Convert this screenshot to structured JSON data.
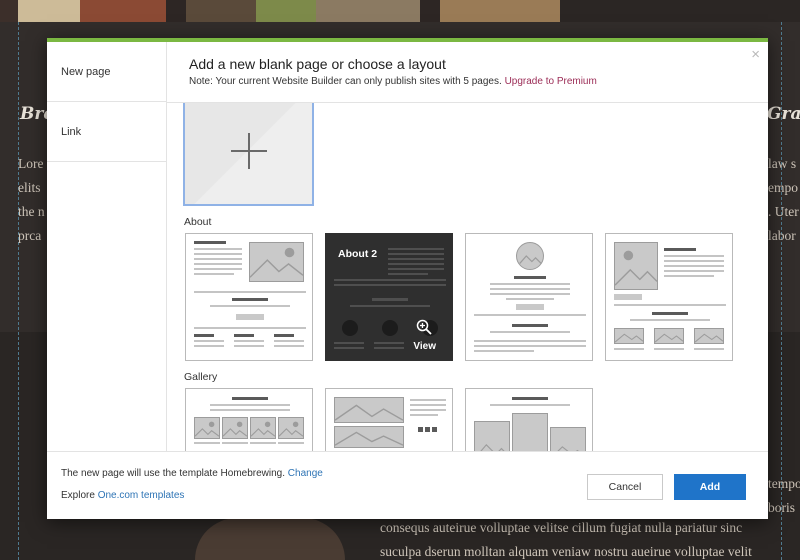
{
  "background": {
    "heading_left": "Bre",
    "heading_right": "Grai",
    "left_lines": [
      "Lore",
      "elits",
      "the n",
      "prca"
    ],
    "right_lines": [
      "law s",
      "empo",
      ". Uter",
      "labor"
    ],
    "right_low_lines": [
      "tempo",
      "boris"
    ],
    "bottom_lines": [
      "consequs auteiruе volluptae velitse cillum fugiat nulla pariatur sinc",
      "suculpa dserun molltan alquam veniaw nostru aueiruе volluptae velit"
    ]
  },
  "modal": {
    "close_label": "×",
    "sidebar": {
      "items": [
        {
          "label": "New page"
        },
        {
          "label": "Link"
        }
      ]
    },
    "header": {
      "title": "Add a new blank page or choose a layout",
      "note": "Note: Your current Website Builder can only publish sites with 5 pages.",
      "upgrade_link": "Upgrade to Premium"
    },
    "sections": {
      "about": "About",
      "gallery": "Gallery"
    },
    "about_hover": {
      "title": "About 2",
      "view_label": "View"
    },
    "footer": {
      "template_text": "The new page will use the template Homebrewing.",
      "change_link": "Change",
      "explore_text": "Explore",
      "templates_link": "One.com templates",
      "cancel_label": "Cancel",
      "add_label": "Add"
    },
    "colors": {
      "accent_green": "#7bb842",
      "primary_blue": "#1f74c9",
      "link_blue": "#2e74b5",
      "upgrade_link": "#9b2c56"
    }
  }
}
